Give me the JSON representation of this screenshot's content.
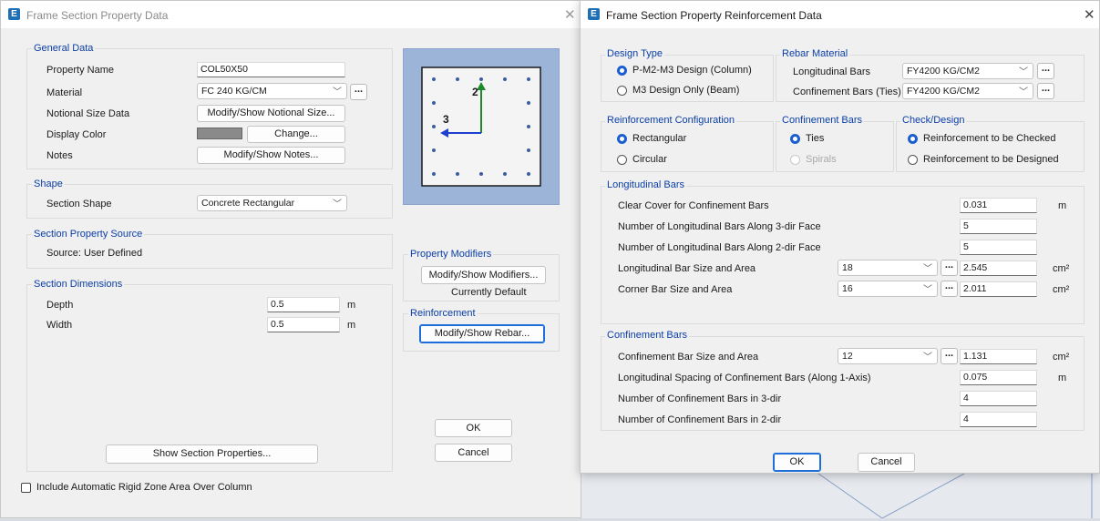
{
  "left_window": {
    "title": "Frame Section Property Data",
    "general": {
      "title": "General Data",
      "property_name_label": "Property Name",
      "property_name_value": "COL50X50",
      "material_label": "Material",
      "material_value": "FC 240 KG/CM",
      "notional_label": "Notional Size Data",
      "notional_button": "Modify/Show Notional Size...",
      "display_color_label": "Display Color",
      "change_button": "Change...",
      "notes_label": "Notes",
      "notes_button": "Modify/Show Notes..."
    },
    "shape": {
      "title": "Shape",
      "section_shape_label": "Section Shape",
      "section_shape_value": "Concrete Rectangular"
    },
    "source": {
      "title": "Section Property Source",
      "text": "Source:  User Defined"
    },
    "dimensions": {
      "title": "Section Dimensions",
      "depth_label": "Depth",
      "depth_value": "0.5",
      "depth_unit": "m",
      "width_label": "Width",
      "width_value": "0.5",
      "width_unit": "m"
    },
    "preview": {
      "axis2": "2",
      "axis3": "3"
    },
    "modifiers": {
      "title": "Property Modifiers",
      "button": "Modify/Show Modifiers...",
      "status": "Currently Default"
    },
    "reinforcement": {
      "title": "Reinforcement",
      "button": "Modify/Show Rebar..."
    },
    "show_props_button": "Show Section Properties...",
    "ok": "OK",
    "cancel": "Cancel",
    "rigid_zone_label": "Include Automatic Rigid Zone Area Over Column"
  },
  "right_window": {
    "title": "Frame Section Property Reinforcement Data",
    "design_type": {
      "title": "Design Type",
      "option1": "P-M2-M3 Design  (Column)",
      "option2": "M3 Design Only  (Beam)"
    },
    "rebar_material": {
      "title": "Rebar Material",
      "longitudinal_label": "Longitudinal Bars",
      "longitudinal_value": "FY4200 KG/CM2",
      "confinement_label": "Confinement Bars (Ties)",
      "confinement_value": "FY4200 KG/CM2"
    },
    "config": {
      "title": "Reinforcement Configuration",
      "option1": "Rectangular",
      "option2": "Circular"
    },
    "confinement_type": {
      "title": "Confinement Bars",
      "option1": "Ties",
      "option2": "Spirals"
    },
    "check_design": {
      "title": "Check/Design",
      "option1": "Reinforcement to be Checked",
      "option2": "Reinforcement to be Designed"
    },
    "longitudinal": {
      "title": "Longitudinal Bars",
      "cover_label": "Clear Cover for Confinement Bars",
      "cover_value": "0.031",
      "cover_unit": "m",
      "n3_label": "Number of Longitudinal Bars Along 3-dir Face",
      "n3_value": "5",
      "n2_label": "Number of Longitudinal Bars Along 2-dir Face",
      "n2_value": "5",
      "bar_label": "Longitudinal Bar Size and Area",
      "bar_size": "18",
      "bar_area": "2.545",
      "bar_unit": "cm²",
      "corner_label": "Corner Bar Size and Area",
      "corner_size": "16",
      "corner_area": "2.011",
      "corner_unit": "cm²"
    },
    "confinement": {
      "title": "Confinement Bars",
      "size_label": "Confinement Bar Size and Area",
      "size_value": "12",
      "area_value": "1.131",
      "area_unit": "cm²",
      "spacing_label": "Longitudinal Spacing of Confinement Bars  (Along 1-Axis)",
      "spacing_value": "0.075",
      "spacing_unit": "m",
      "n3_label": "Number of Confinement Bars in 3-dir",
      "n3_value": "4",
      "n2_label": "Number of Confinement Bars in 2-dir",
      "n2_value": "4"
    },
    "ok": "OK",
    "cancel": "Cancel"
  },
  "colors": {
    "accent": "#1a5ed1",
    "group_title": "#0b3ea6",
    "preview_bg": "#9db4d9",
    "bar_dot": "#3a5f9e",
    "axis2": "#1a8a2a",
    "axis3": "#1d3fd0"
  }
}
